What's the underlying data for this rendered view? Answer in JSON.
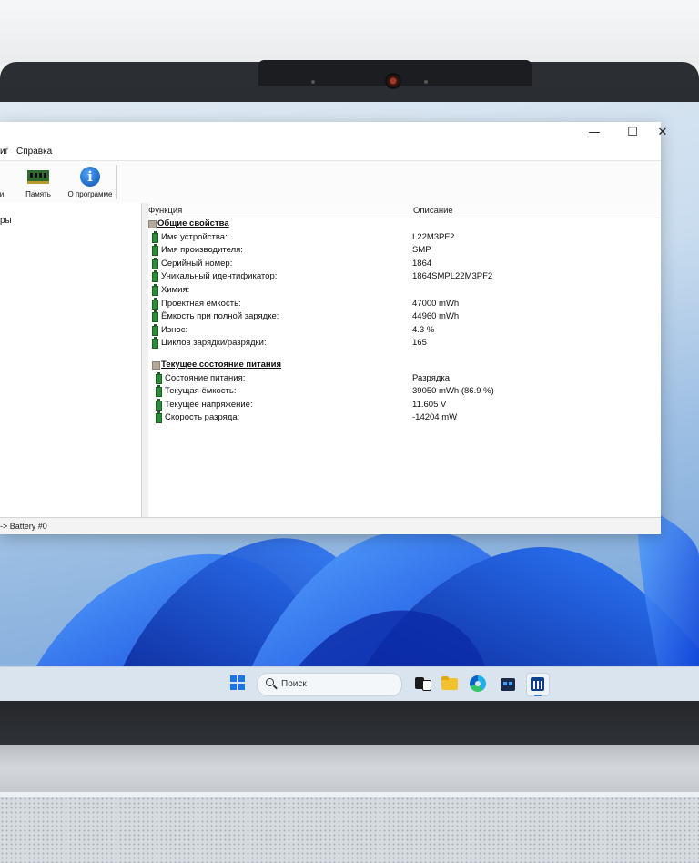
{
  "menubar": {
    "items": [
      "иг",
      "Справка"
    ]
  },
  "window_controls": {
    "minimize": "—",
    "maximize": "☐",
    "close": "✕"
  },
  "toolbar": {
    "left_cut_label": "и",
    "memory_label": "Память",
    "about_label": "О программе"
  },
  "left_pane": {
    "cut_text": "ры"
  },
  "columns": {
    "feature": "Функция",
    "description": "Описание"
  },
  "sections": [
    {
      "title": "Общие свойства",
      "rows": [
        {
          "key": "Имя устройства:",
          "value": "L22M3PF2"
        },
        {
          "key": "Имя производителя:",
          "value": "SMP"
        },
        {
          "key": "Серийный номер:",
          "value": "1864"
        },
        {
          "key": "Уникальный идентификатор:",
          "value": "1864SMPL22M3PF2"
        },
        {
          "key": "Химия:",
          "value": ""
        },
        {
          "key": "Проектная ёмкость:",
          "value": "47000 mWh"
        },
        {
          "key": "Ёмкость при полной зарядке:",
          "value": "44960 mWh"
        },
        {
          "key": "Износ:",
          "value": "4.3 %"
        },
        {
          "key": "Циклов зарядки/разрядки:",
          "value": "165"
        }
      ]
    },
    {
      "title": "Текущее состояние питания",
      "rows": [
        {
          "key": "Состояние питания:",
          "value": "Разрядка"
        },
        {
          "key": "Текущая ёмкость:",
          "value": "39050 mWh (86.9 %)"
        },
        {
          "key": "Текущее напряжение:",
          "value": "11.605 V"
        },
        {
          "key": "Скорость разряда:",
          "value": "-14204 mW"
        }
      ]
    }
  ],
  "statusbar": {
    "text": "-> Battery #0"
  },
  "taskbar": {
    "search_placeholder": "Поиск",
    "icons": [
      "windows-start-icon",
      "task-view-icon",
      "file-explorer-icon",
      "edge-browser-icon",
      "store-icon",
      "aida-app-icon"
    ]
  },
  "colors": {
    "accent": "#1a73e8",
    "bezel": "#202226",
    "battery_green": "#2e8b3a"
  }
}
